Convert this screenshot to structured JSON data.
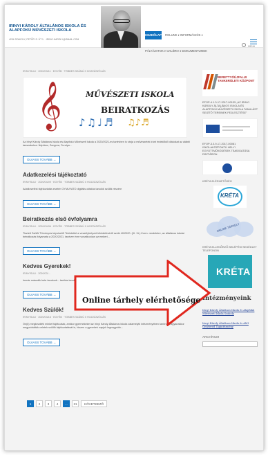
{
  "header": {
    "site_title": "IRINYI KÁROLY ÁLTALÁNOS ISKOLA ÉS ALAPFOKÚ MŰVÉSZETI ISKOLA",
    "site_subline": "4234 SZAKOLY, PETŐFI S. ÚT 1. · IRINYI.KAROLY@GMAIL.COM",
    "nav": {
      "home": "KEZDŐLAP",
      "row1": "ROLUNK ▾    INFORMÁCIÓK ▾",
      "row2": "PÁLYÁZATOK ▾   GALÉRIA ▾   DOKUMENTUMOK"
    },
    "menu_label": "MENU"
  },
  "posts": [
    {
      "meta": "IRINYISULI · 2020/03/11 · EGYÉB · TÖBBES SZÁMÚ 0 HOZZÁSZÓLÁS",
      "image": {
        "title": "MŰVÉSZETI ISKOLA",
        "subtitle": "BEIRATKOZÁS"
      },
      "excerpt": "Az Irinyi Károly Általános Iskola és Alapfokú Művészeti Iskola a 2020/2021-es tanévben is várja a művészetek iránt érdeklődő diákokat az alábbi tanszakokra: Néptánc, Zongora, Furulya…",
      "more": "OLVASS TOVÁBB →"
    },
    {
      "title": "Adatkezelési tájékoztató",
      "meta": "IRINYISULI · 2020/04/09 · EGYÉB · TÖBBES SZÁMÚ 0 HOZZÁSZÓLÁS",
      "excerpt": "Adatkezelési tájékoztatás esetén GYMUYATO digitális oktatás tanulók szülők részére",
      "more": "OLVASS TOVÁBB →"
    },
    {
      "title": "Beiratkozás első évfolyamra",
      "meta": "IRINYISULI · 2020/04/06 · EGYÉB · TÖBBES SZÁMÚ 0 HOZZÁSZÓLÁS",
      "excerpt": "Tisztelt Szülő/ Törvényes képviselő! Tekintettel a veszélyhelyzet kihirdetéséről szóló 40/2020. (III. 11.) Korm. rendeletre, az általános iskolai beiratkozás folyamata a 2020/2021. tanévre évre vonatkozóan az emberi…",
      "more": "OLVASS TOVÁBB →"
    },
    {
      "title": "Kedves Gyerekek!",
      "meta": "IRINYISULI · 2020/03/...",
      "excerpt": "Immár második hete tanulunk... tanítás tanulás formája. Az...",
      "more": "OLVASS TOVÁBB →"
    },
    {
      "title": "Kedves Szülők!",
      "meta": "IRINYISULI · 2020/03/16 · EGYÉB · TÖBBES SZÁMÚ 0 HOZZÁSZÓLÁS",
      "excerpt": "Ön(k) megkezdték minket tájékoztak, amikor gyermekeket az Irinyi Károly Általános Iskola valamelyik intézményében tanítnak. Ugyanakkor megpróbálták veletek szülők tájékoztatását is, hiszen a gyerekek napjuk legnagyobb...",
      "more": "OLVASS TOVÁBB →"
    }
  ],
  "pagination": {
    "pages": [
      "1",
      "2",
      "3",
      "4",
      "...",
      "21"
    ],
    "active": "1",
    "next": "KÖVETKEZŐ"
  },
  "sidebar": {
    "logo_text": "BERETTYÓÚJFALUI TANKERÜLETI KÖZPONT",
    "efop1": "EFOP-4.1.3-17-2017-00135 „AZ IRINYI KÁROLY ÁLTALÁNOS ISKOLA ÉS ALAPFOKÚ MŰVÉSZETI ISKOLA TANULÁST SEGÍTŐ TEREINEK FEJLESZTÉSE”",
    "efop2": "EFOP-3.3.9-17-2017-00081 ISKOLAKÖZPONTÚ HELYI EGYÜTTMŰKÖDÉSEK TÁMOGATÁSA DSZTÁRON",
    "kreta_heading": "KRÉTA ELÉRHETŐSÉG",
    "kreta_small": "KRÉTA",
    "cloud_label": "ONLINE TÁRHELY",
    "kreta_parent_heading": "KRÉTA ELLENŐRZŐ BELÉPÉSI SEGÉDLET TELEFONON",
    "kreta_big": "KRÉTA",
    "institutions_heading": "Intézményeink",
    "inst_link1": "Irinyi Károly Általános Iskola és Alapfokú Művészeti Iskola Szakoly",
    "inst_link2": "Irinyi Károly Általános Iskola és AMI Geszteréd Tagintézmény",
    "archive_label": "ARCHÍVUM"
  },
  "annotation": {
    "text": "Online tárhely elérhetősége",
    "color": "#e0281f"
  },
  "colors": {
    "accent": "#1173c0",
    "annotation_red": "#e0281f"
  }
}
